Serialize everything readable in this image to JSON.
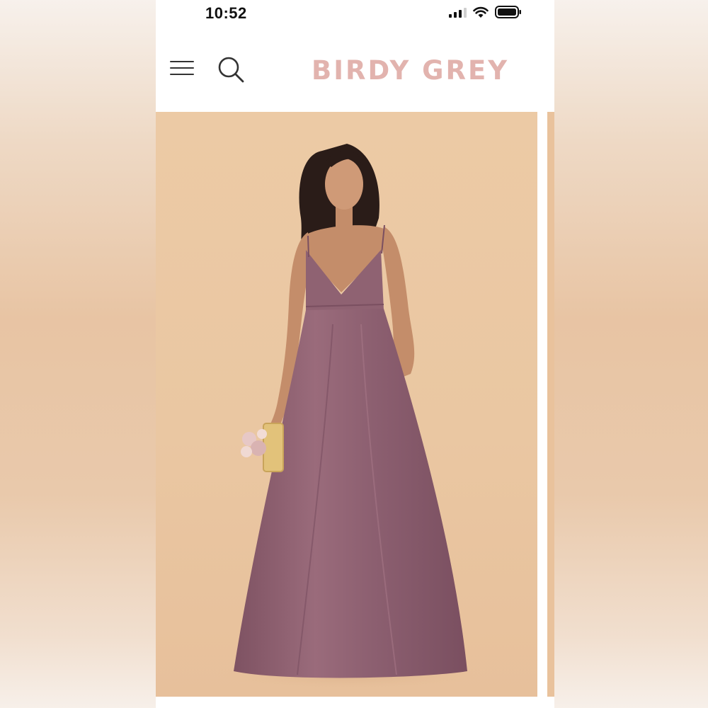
{
  "status_bar": {
    "time": "10:52"
  },
  "header": {
    "menu_icon": "hamburger-menu-icon",
    "search_icon": "search-icon",
    "logo": "BIRDY GREY",
    "logo_color": "#e2b3ae"
  },
  "gallery": {
    "dress_color": "#8f6272",
    "background_color": "#eac7a2"
  }
}
